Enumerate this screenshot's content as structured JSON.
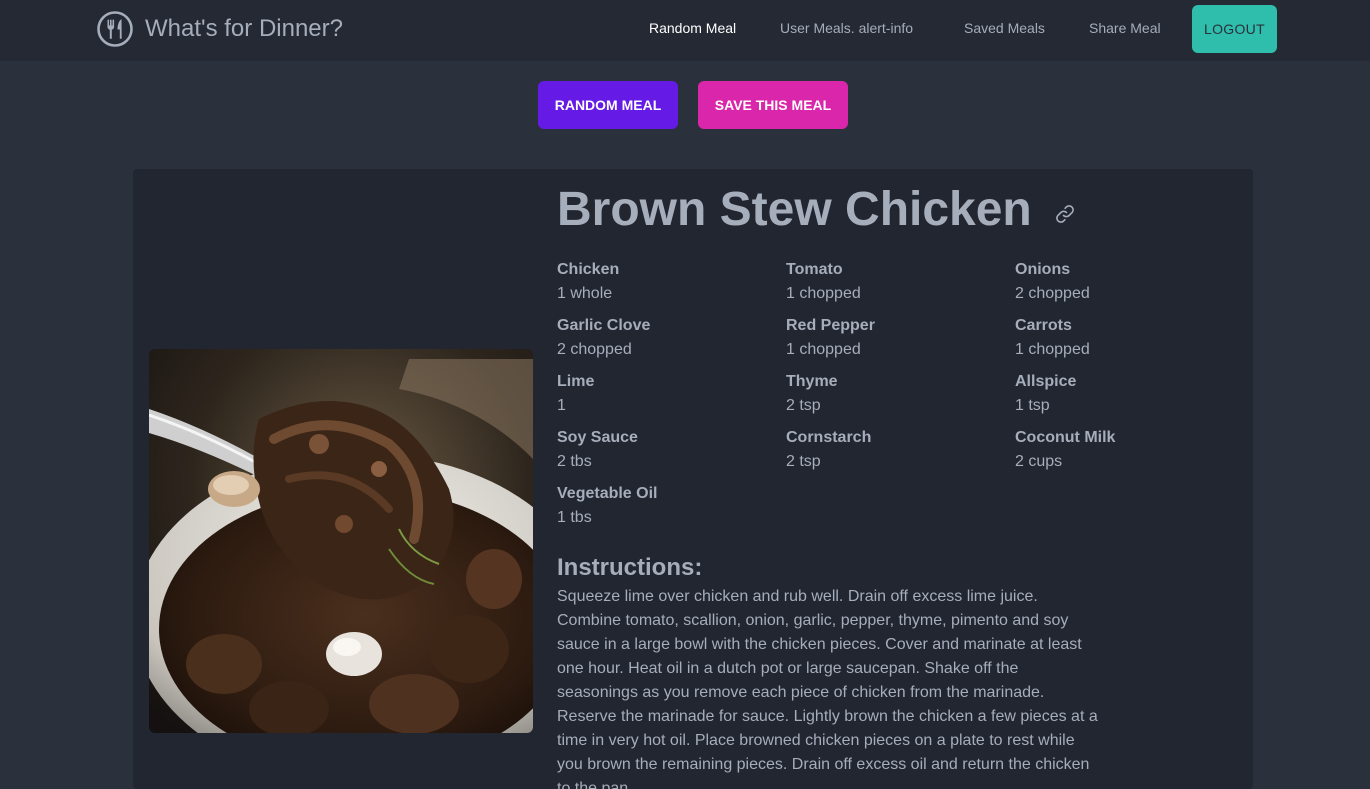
{
  "nav": {
    "brand": "What's for Dinner?",
    "links": [
      "Random Meal",
      "User Meals. alert-info",
      "Saved Meals",
      "Share Meal"
    ],
    "logout": "LOGOUT"
  },
  "actions": {
    "random": "RANDOM MEAL",
    "save": "SAVE THIS MEAL"
  },
  "meal": {
    "title": "Brown Stew Chicken",
    "ingredients": [
      {
        "name": "Chicken",
        "measure": "1 whole"
      },
      {
        "name": "Tomato",
        "measure": "1 chopped"
      },
      {
        "name": "Onions",
        "measure": "2 chopped"
      },
      {
        "name": "Garlic Clove",
        "measure": "2 chopped"
      },
      {
        "name": "Red Pepper",
        "measure": "1 chopped"
      },
      {
        "name": "Carrots",
        "measure": "1 chopped"
      },
      {
        "name": "Lime",
        "measure": "1"
      },
      {
        "name": "Thyme",
        "measure": "2 tsp"
      },
      {
        "name": "Allspice",
        "measure": "1 tsp"
      },
      {
        "name": "Soy Sauce",
        "measure": "2 tbs"
      },
      {
        "name": "Cornstarch",
        "measure": "2 tsp"
      },
      {
        "name": "Coconut Milk",
        "measure": "2 cups"
      },
      {
        "name": "Vegetable Oil",
        "measure": "1 tbs"
      }
    ],
    "instructions_heading": "Instructions:",
    "instructions": "Squeeze lime over chicken and rub well. Drain off excess lime juice. Combine tomato, scallion, onion, garlic, pepper, thyme, pimento and soy sauce in a large bowl with the chicken pieces. Cover and marinate at least one hour. Heat oil in a dutch pot or large saucepan. Shake off the seasonings as you remove each piece of chicken from the marinade. Reserve the marinade for sauce. Lightly brown the chicken a few pieces at a time in very hot oil. Place browned chicken pieces on a plate to rest while you brown the remaining pieces. Drain off excess oil and return the chicken to the pan."
  },
  "icons": {
    "logo": "fork-knife-logo-icon",
    "title_link": "link-icon"
  },
  "colors": {
    "page_bg": "#2a303c",
    "navbar_bg": "#242933",
    "card_bg": "#222630",
    "text": "#a6adbb",
    "primary": "#661ae6",
    "secondary": "#d926aa",
    "accent": "#2ebeab"
  }
}
